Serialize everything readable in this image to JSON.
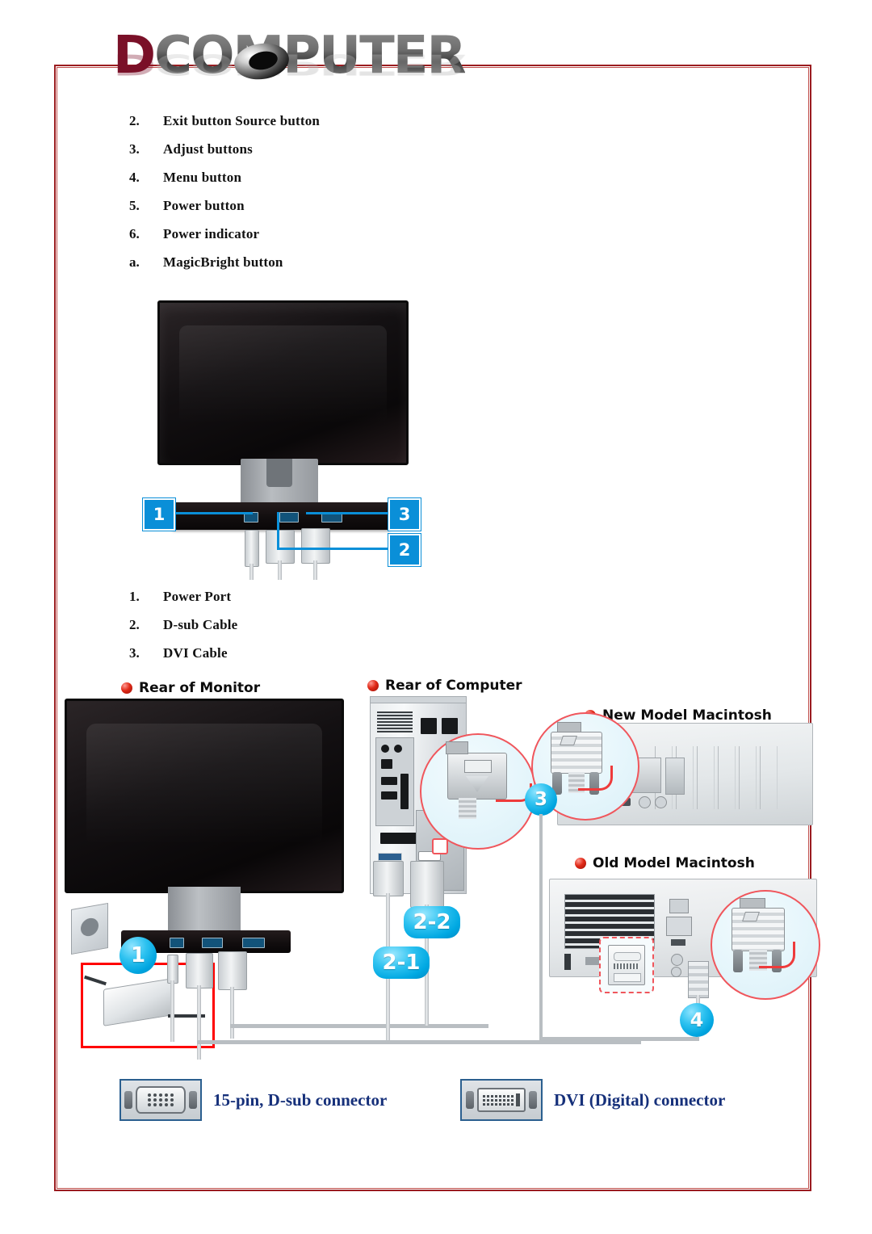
{
  "logo": {
    "first_letter": "D",
    "rest": "COMPUTER",
    "full_text": "DCOMPUTER"
  },
  "button_list": {
    "items": [
      {
        "index": "2.",
        "label": "Exit button Source button"
      },
      {
        "index": "3.",
        "label": "Adjust buttons"
      },
      {
        "index": "4.",
        "label": "Menu button"
      },
      {
        "index": "5.",
        "label": "Power button"
      },
      {
        "index": "6.",
        "label": "Power indicator"
      },
      {
        "index": "a.",
        "label": "MagicBright button"
      }
    ]
  },
  "cable_list": {
    "items": [
      {
        "index": "1.",
        "label": "Power Port"
      },
      {
        "index": "2.",
        "label": "D-sub Cable"
      },
      {
        "index": "3.",
        "label": "DVI Cable"
      }
    ]
  },
  "top_figure": {
    "callouts": [
      {
        "id": "1",
        "text": "1"
      },
      {
        "id": "3",
        "text": "3"
      },
      {
        "id": "2",
        "text": "2"
      }
    ]
  },
  "bottom_figure": {
    "headings": [
      {
        "id": "rear-of-monitor",
        "text": "Rear of Monitor"
      },
      {
        "id": "rear-of-computer",
        "text": "Rear of Computer"
      },
      {
        "id": "new-model-macintosh",
        "text": "New Model Macintosh"
      },
      {
        "id": "old-model-macintosh",
        "text": "Old Model Macintosh"
      }
    ],
    "callouts": [
      {
        "id": "power",
        "text": "1"
      },
      {
        "id": "dsub-to-pc",
        "text": "2-1"
      },
      {
        "id": "dvi-to-pc",
        "text": "2-2"
      },
      {
        "id": "new-mac",
        "text": "3"
      },
      {
        "id": "old-mac",
        "text": "4"
      }
    ]
  },
  "connector_legend": [
    {
      "icon": "dsub-connector-icon",
      "label": "15-pin, D-sub connector"
    },
    {
      "icon": "dvi-connector-icon",
      "label": "DVI (Digital) connector"
    }
  ],
  "colors": {
    "border": "#9b1c20",
    "callout_blue": "#0a8fd8",
    "legend_text": "#16307a",
    "highlight_red": "#ff0000",
    "logo_d": "#7a1028"
  }
}
